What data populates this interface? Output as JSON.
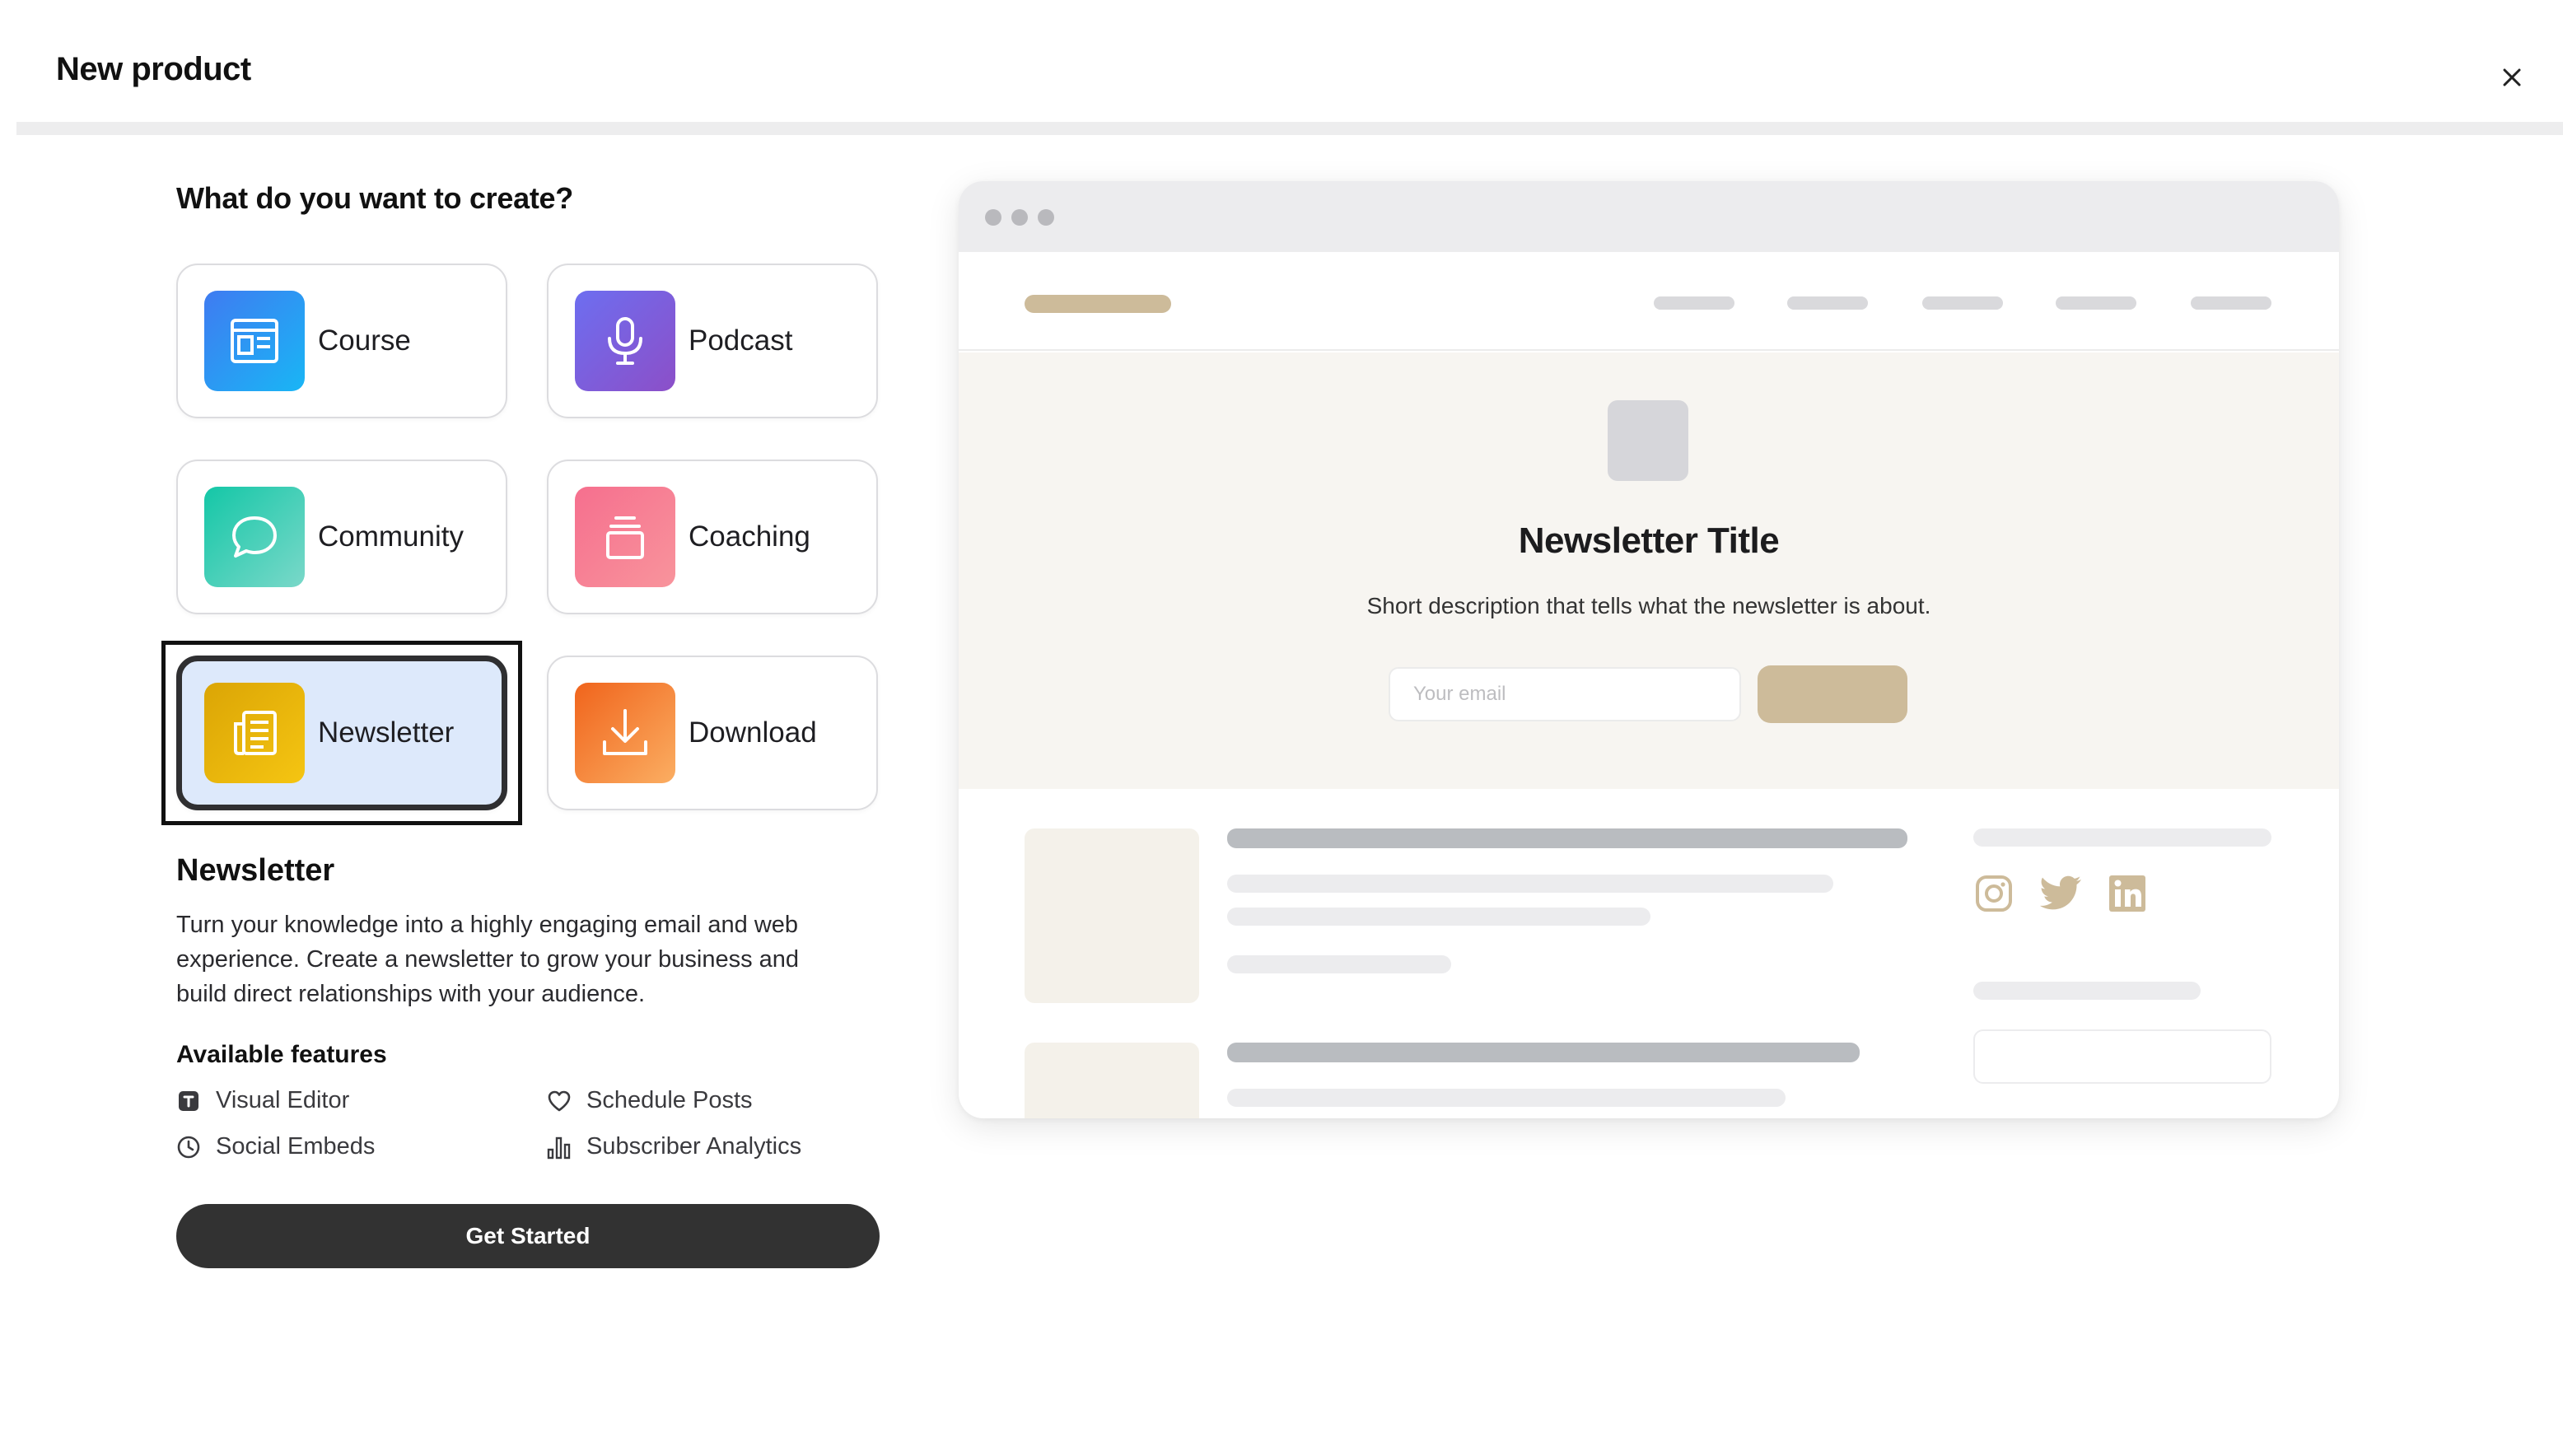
{
  "header": {
    "title": "New product",
    "close_icon": "close-icon"
  },
  "chooser": {
    "question": "What do you want to create?",
    "selected": "Newsletter",
    "types": [
      {
        "label": "Course",
        "icon": "course-icon"
      },
      {
        "label": "Podcast",
        "icon": "microphone-icon"
      },
      {
        "label": "Community",
        "icon": "chat-bubble-icon"
      },
      {
        "label": "Coaching",
        "icon": "coaching-icon"
      },
      {
        "label": "Newsletter",
        "icon": "newsletter-icon"
      },
      {
        "label": "Download",
        "icon": "download-icon"
      }
    ]
  },
  "details": {
    "title": "Newsletter",
    "description": "Turn your knowledge into a highly engaging email and web experience. Create a newsletter to grow your business and build direct relationships with your audience.",
    "features_title": "Available features",
    "features": [
      {
        "label": "Visual Editor",
        "icon": "text-box-icon"
      },
      {
        "label": "Schedule Posts",
        "icon": "heart-icon"
      },
      {
        "label": "Social Embeds",
        "icon": "clock-icon"
      },
      {
        "label": "Subscriber Analytics",
        "icon": "bar-chart-icon"
      }
    ],
    "cta_label": "Get Started"
  },
  "preview": {
    "title": "Newsletter Title",
    "subtitle": "Short description that tells what the newsletter is about.",
    "email_placeholder": "Your email",
    "accent_color": "#cdbb9a",
    "social_icons": [
      "instagram-icon",
      "twitter-icon",
      "linkedin-icon"
    ]
  }
}
